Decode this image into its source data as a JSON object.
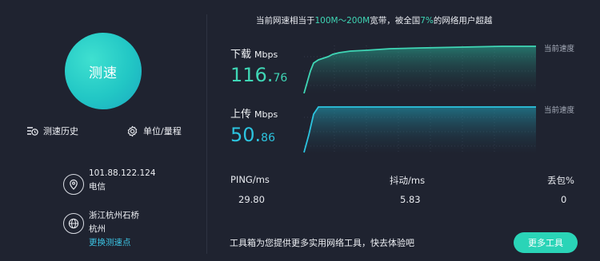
{
  "left": {
    "speed_test_label": "测速",
    "history_label": "测速历史",
    "units_label": "单位/量程",
    "ip": "101.88.122.124",
    "isp": "电信",
    "server_name": "浙江杭州石桥",
    "server_city": "杭州",
    "change_server_link": "更换测速点"
  },
  "summary": {
    "prefix": "当前网速相当于",
    "bandwidth": "100M～200M",
    "middle": "宽带，被全国",
    "percent": "7%",
    "suffix": "的网络用户超越"
  },
  "download": {
    "label": "下载",
    "unit": "Mbps",
    "value_int": "116.",
    "value_dec": "76",
    "current_label": "当前速度"
  },
  "upload": {
    "label": "上传",
    "unit": "Mbps",
    "value_int": "50.",
    "value_dec": "86",
    "current_label": "当前速度"
  },
  "stats": {
    "ping_label": "PING/ms",
    "ping_value": "29.80",
    "jitter_label": "抖动/ms",
    "jitter_value": "5.83",
    "loss_label": "丢包%",
    "loss_value": "0"
  },
  "footer": {
    "text": "工具箱为您提供更多实用网络工具，快去体验吧",
    "more_button": "更多工具"
  },
  "colors": {
    "accent": "#2ad4b7",
    "download": "#3fd6b5",
    "upload": "#2cc4df",
    "background": "#1f2330"
  }
}
